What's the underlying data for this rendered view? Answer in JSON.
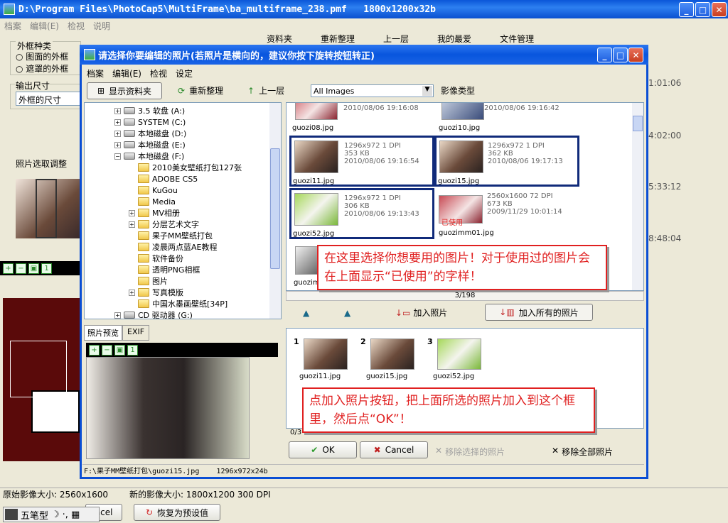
{
  "app": {
    "title": "D:\\Program Files\\PhotoCap5\\MultiFrame\\ba_multiframe_238.pmf   1800x1200x32b",
    "menu": [
      "档案",
      "编辑(E)",
      "检视",
      "说明"
    ]
  },
  "bg": {
    "frame_group": "外框种类",
    "radio1": "图面的外框",
    "radio2": "遮罩的外框",
    "output_size": "输出尺寸",
    "output_value": "外框的尺寸",
    "photo_adjust": "照片选取调整",
    "toolbar": [
      "资料夹",
      "重新整理",
      "上一层",
      "我的最爱",
      "文件管理"
    ],
    "times": [
      "1:01:06",
      "4:02:00",
      "5:33:12",
      "8:48:04"
    ],
    "status_orig": "原始影像大小: 2560x1600",
    "status_new": "新的影像大小: 1800x1200 300 DPI",
    "cancel": "ncel",
    "reset": "恢复为预设值",
    "ime": "五笔型"
  },
  "dialog": {
    "title": "请选择你要编辑的照片(若照片是横向的，建议你按下旋转按钮转正)",
    "menu": [
      "档案",
      "编辑(E)",
      "检视",
      "设定"
    ],
    "show_folder": "显示资料夹",
    "refresh": "重新整理",
    "up": "上一层",
    "filter": "All Images",
    "filter_label": "影像类型",
    "tree": [
      {
        "l": "3.5 软盘 (A:)",
        "t": "drive"
      },
      {
        "l": "SYSTEM (C:)",
        "t": "drive"
      },
      {
        "l": "本地磁盘 (D:)",
        "t": "drive"
      },
      {
        "l": "本地磁盘 (E:)",
        "t": "drive"
      },
      {
        "l": "本地磁盘 (F:)",
        "t": "drive"
      },
      {
        "l": "2010美女壁纸打包127张",
        "t": "folder"
      },
      {
        "l": "ADOBE CS5",
        "t": "folder"
      },
      {
        "l": "KuGou",
        "t": "folder"
      },
      {
        "l": "Media",
        "t": "folder"
      },
      {
        "l": "MV相册",
        "t": "folder"
      },
      {
        "l": "分层艺术文字",
        "t": "folder"
      },
      {
        "l": "果子MM壁纸打包",
        "t": "folder"
      },
      {
        "l": "凌晨两点蓝AE教程",
        "t": "folder"
      },
      {
        "l": "软件备份",
        "t": "folder"
      },
      {
        "l": "透明PNG相框",
        "t": "folder"
      },
      {
        "l": "图片",
        "t": "folder"
      },
      {
        "l": "写真模版",
        "t": "folder"
      },
      {
        "l": "中国水墨画壁纸[34P]",
        "t": "folder"
      },
      {
        "l": "CD 驱动器 (G:)",
        "t": "drive"
      }
    ],
    "preview_tab": "照片预览",
    "exif_tab": "EXIF",
    "thumbs": [
      {
        "name": "guozi08.jpg",
        "meta": "2010/08/06 19:16:08"
      },
      {
        "name": "guozi10.jpg",
        "meta": "2010/08/06 19:16:42"
      },
      {
        "name": "guozi11.jpg",
        "meta": "1296x972 1 DPI\n353 KB\n2010/08/06 19:16:54"
      },
      {
        "name": "guozi15.jpg",
        "meta": "1296x972 1 DPI\n362 KB\n2010/08/06 19:17:13"
      },
      {
        "name": "guozi52.jpg",
        "meta": "1296x972 1 DPI\n306 KB\n2010/08/06 19:13:43"
      },
      {
        "name": "guozimm01.jpg",
        "meta": "2560x1600 72 DPI\n673 KB\n2009/11/29 10:01:14"
      },
      {
        "name": "guozim"
      }
    ],
    "used_badge": "已使用",
    "count": "3/198",
    "add_photo": "加入照片",
    "add_all": "加入所有的照片",
    "selected": [
      {
        "n": "1",
        "name": "guozi11.jpg"
      },
      {
        "n": "2",
        "name": "guozi15.jpg"
      },
      {
        "n": "3",
        "name": "guozi52.jpg"
      }
    ],
    "sel_count": "0/3",
    "ok": "OK",
    "cancel": "Cancel",
    "remove_sel": "移除选择的照片",
    "remove_all": "移除全部照片",
    "status": "F:\\果子MM壁纸打包\\guozi15.jpg    1296x972x24b"
  },
  "callouts": {
    "top": "在这里选择你想要用的图片！对于使用过的图片会在上面显示“已使用”的字样！",
    "bottom": "点加入照片按钮，把上面所选的照片加入到这个框里，然后点“OK”！"
  },
  "colors": {
    "title_blue": "#0a4ed4",
    "selection": "#102a7a",
    "callout_red": "#e02020"
  }
}
